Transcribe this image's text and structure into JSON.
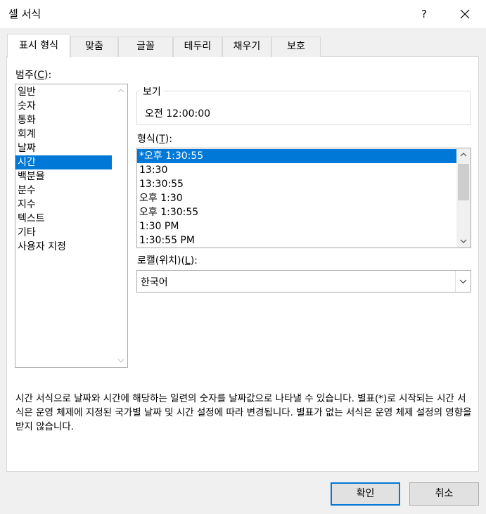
{
  "window": {
    "title": "셀 서식",
    "help_label": "?"
  },
  "tabs": [
    {
      "label": "표시 형식"
    },
    {
      "label": "맞춤"
    },
    {
      "label": "글꼴"
    },
    {
      "label": "테두리"
    },
    {
      "label": "채우기"
    },
    {
      "label": "보호"
    }
  ],
  "category": {
    "label_prefix": "범주(",
    "label_key": "C",
    "label_suffix": "):",
    "items": [
      "일반",
      "숫자",
      "통화",
      "회계",
      "날짜",
      "시간",
      "백분율",
      "분수",
      "지수",
      "텍스트",
      "기타",
      "사용자 지정"
    ],
    "selected": "시간"
  },
  "sample": {
    "label": "보기",
    "value": "오전 12:00:00"
  },
  "type": {
    "label_prefix": "형식(",
    "label_key": "T",
    "label_suffix": "):",
    "items": [
      "*오후 1:30:55",
      "13:30",
      "13:30:55",
      "오후 1:30",
      "오후 1:30:55",
      "1:30 PM",
      "1:30:55 PM"
    ],
    "selected": "*오후 1:30:55"
  },
  "locale": {
    "label_prefix": "로캘(위치)(",
    "label_key": "L",
    "label_suffix": "):",
    "value": "한국어"
  },
  "description": "시간 서식으로 날짜와 시간에 해당하는 일련의 숫자를 날짜값으로 나타낼 수 있습니다. 별표(*)로 시작되는 시간 서식은 운영 체제에 지정된 국가별 날짜 및 시간 설정에 따라 변경됩니다. 별표가 없는 서식은 운영 체제 설정의 영향을 받지 않습니다.",
  "buttons": {
    "ok": "확인",
    "cancel": "취소"
  },
  "colors": {
    "selection": "#0078d7",
    "background": "#f0f0f0",
    "panel": "#ffffff"
  }
}
